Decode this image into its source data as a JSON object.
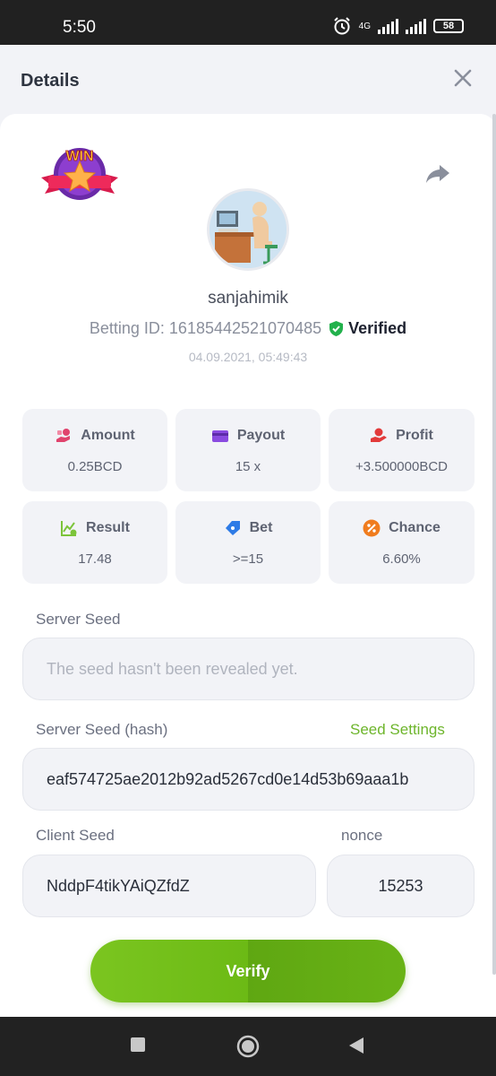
{
  "status_bar": {
    "time": "5:50",
    "network": "4G",
    "battery": "58"
  },
  "header": {
    "title": "Details"
  },
  "bet": {
    "username": "sanjahimik",
    "betting_id_label": "Betting ID:",
    "betting_id": "16185442521070485",
    "verified_label": "Verified",
    "datetime": "04.09.2021, 05:49:43"
  },
  "stats": [
    {
      "label": "Amount",
      "value": "0.25BCD",
      "icon": "money-hand-icon",
      "color": "#e0436d"
    },
    {
      "label": "Payout",
      "value": "15 x",
      "icon": "card-icon",
      "color": "#8a4be0"
    },
    {
      "label": "Profit",
      "value": "+3.500000BCD",
      "icon": "profit-hand-icon",
      "color": "#e23a3a"
    },
    {
      "label": "Result",
      "value": "17.48",
      "icon": "result-chart-icon",
      "color": "#7cc43a"
    },
    {
      "label": "Bet",
      "value": ">=15",
      "icon": "tag-icon",
      "color": "#2e7be6"
    },
    {
      "label": "Chance",
      "value": "6.60%",
      "icon": "percent-icon",
      "color": "#f07c1e"
    }
  ],
  "server_seed": {
    "label": "Server Seed",
    "placeholder": "The seed hasn't been revealed yet."
  },
  "server_seed_hash": {
    "label": "Server Seed (hash)",
    "settings_link": "Seed Settings",
    "value": "eaf574725ae2012b92ad5267cd0e14d53b69aaa1b"
  },
  "client_seed": {
    "label": "Client Seed",
    "value": "NddpF4tikYAiQZfdZ"
  },
  "nonce": {
    "label": "nonce",
    "value": "15253"
  },
  "verify_button": {
    "label": "Verify"
  },
  "badge": {
    "text": "WIN"
  },
  "colors": {
    "accent": "#6db52b",
    "verified": "#22b14c"
  }
}
